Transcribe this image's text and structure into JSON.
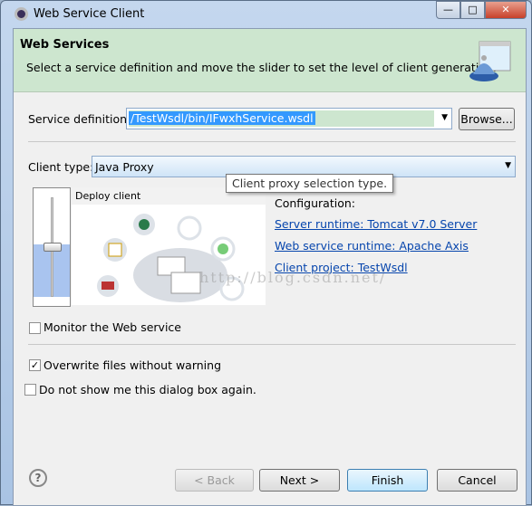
{
  "window": {
    "title": "Web Service Client",
    "minimize": "—",
    "maximize": "□",
    "close": "✕"
  },
  "banner": {
    "title": "Web Services",
    "description": "Select a service definition and move the slider to set the level of client generation."
  },
  "service_definition": {
    "label": "Service definition:",
    "value": "/TestWsdl/bin/IFwxhService.wsdl",
    "browse": "Browse..."
  },
  "client_type": {
    "label": "Client type:",
    "value": "Java Proxy",
    "tooltip": "Client proxy selection type."
  },
  "slider": {
    "level_label": "Deploy client",
    "level_index": 3,
    "levels_total": 6
  },
  "configuration": {
    "heading": "Configuration:",
    "server_runtime": "Server runtime: Tomcat v7.0 Server",
    "ws_runtime": "Web service runtime: Apache Axis",
    "client_project": "Client project: TestWsdl"
  },
  "options": {
    "monitor": {
      "label": "Monitor the Web service",
      "checked": false
    },
    "overwrite": {
      "label": "Overwrite files without warning",
      "checked": true
    },
    "do_not_show": {
      "label": "Do not show me this dialog box again.",
      "checked": false
    }
  },
  "buttons": {
    "help": "?",
    "back": "< Back",
    "next": "Next >",
    "finish": "Finish",
    "cancel": "Cancel"
  },
  "watermark": "http://blog.csdn.net/"
}
